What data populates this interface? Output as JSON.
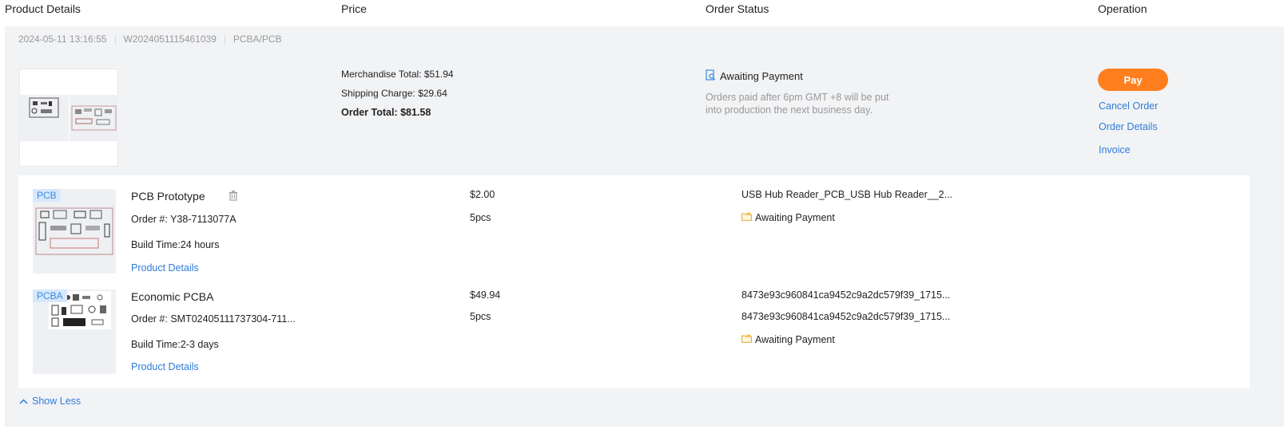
{
  "header": {
    "product_details": "Product Details",
    "price": "Price",
    "order_status": "Order Status",
    "operation": "Operation"
  },
  "order": {
    "datetime": "2024-05-11 13:16:55",
    "order_number": "W2024051115461039",
    "category": "PCBA/PCB",
    "merchandise_total": "Merchandise Total: $51.94",
    "shipping_charge": "Shipping Charge: $29.64",
    "order_total": "Order Total: $81.58",
    "status": "Awaiting Payment",
    "status_note": "Orders paid after 6pm GMT +8 will be put into production the next business day.",
    "pay_label": "Pay",
    "cancel_label": "Cancel Order",
    "details_label": "Order Details",
    "invoice_label": "Invoice",
    "show_less": "Show Less"
  },
  "items": [
    {
      "tag": "PCB",
      "title": "PCB Prototype",
      "order_no": "Order #: Y38-7113077A",
      "build_time": "Build Time:24 hours",
      "details_link": "Product Details",
      "price": "$2.00",
      "qty": "5pcs",
      "file": "USB Hub Reader_PCB_USB Hub Reader__2...",
      "status": "Awaiting Payment"
    },
    {
      "tag": "PCBA",
      "title": "Economic PCBA",
      "order_no": "Order #: SMT02405111737304-711...",
      "build_time": "Build Time:2-3 days",
      "details_link": "Product Details",
      "price": "$49.94",
      "qty": "5pcs",
      "file": "8473e93c960841ca9452c9a2dc579f39_1715...",
      "file2": "8473e93c960841ca9452c9a2dc579f39_1715...",
      "status": "Awaiting Payment"
    }
  ],
  "colors": {
    "accent_orange": "#ff7f1f",
    "link_blue": "#2f7cd8",
    "panel_gray": "#f2f3f5"
  },
  "icons": {
    "status_search": "search-doc-icon",
    "status_folder": "folder-icon",
    "delete": "trash-icon",
    "chevron": "chevron-up-icon"
  }
}
